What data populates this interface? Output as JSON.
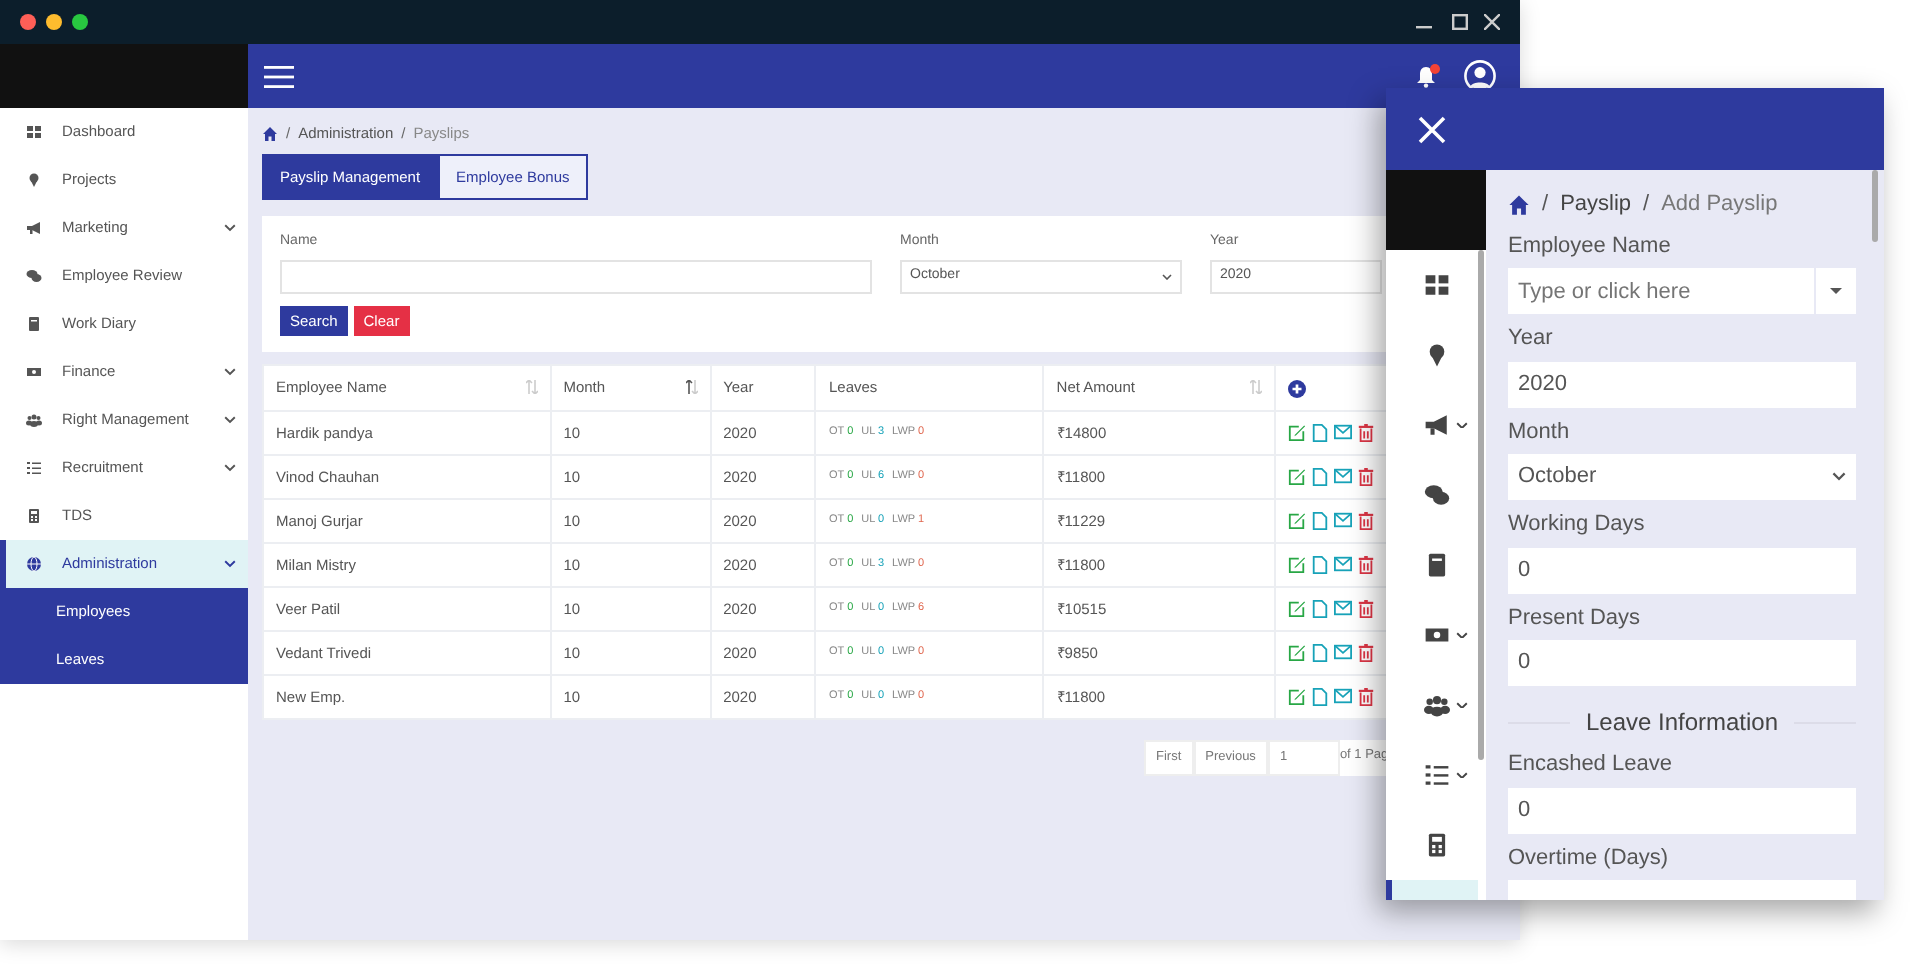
{
  "sidebar": {
    "items": [
      {
        "label": "Dashboard",
        "submenu": false,
        "selected": false
      },
      {
        "label": "Projects",
        "submenu": false,
        "selected": false
      },
      {
        "label": "Marketing",
        "submenu": true,
        "selected": false
      },
      {
        "label": "Employee Review",
        "submenu": false,
        "selected": false
      },
      {
        "label": "Work Diary",
        "submenu": false,
        "selected": false
      },
      {
        "label": "Finance",
        "submenu": true,
        "selected": false
      },
      {
        "label": "Right Management",
        "submenu": true,
        "selected": false
      },
      {
        "label": "Recruitment",
        "submenu": true,
        "selected": false
      },
      {
        "label": "TDS",
        "submenu": false,
        "selected": false
      },
      {
        "label": "Administration",
        "submenu": true,
        "selected": true,
        "expanded": true,
        "children": [
          {
            "label": "Employees",
            "selected": false
          },
          {
            "label": "Leaves",
            "selected": false
          }
        ]
      }
    ]
  },
  "topbar": {
    "notification_badge": true
  },
  "breadcrumb": [
    {
      "kind": "separator",
      "text": "/"
    },
    {
      "kind": "link",
      "text": "Administration"
    },
    {
      "kind": "separator",
      "text": "/"
    },
    {
      "kind": "current",
      "text": "Payslips"
    }
  ],
  "tabs": [
    {
      "label": "Payslip Management",
      "selected": true
    },
    {
      "label": "Employee Bonus",
      "selected": false
    }
  ],
  "filters": {
    "fields": [
      {
        "label": "Name",
        "kind": "text"
      },
      {
        "label": "Month",
        "kind": "select",
        "value": "October"
      },
      {
        "label": "Year",
        "kind": "text",
        "value": "2020"
      }
    ],
    "buttons": [
      {
        "label": "Search",
        "kind": "primary"
      },
      {
        "label": "Clear",
        "kind": "danger"
      }
    ]
  },
  "table": {
    "columns": [
      {
        "label": "Employee Name",
        "sortable": true,
        "sorted": false
      },
      {
        "label": "Month",
        "sortable": true,
        "sorted": true
      },
      {
        "label": "Year",
        "sortable": false
      },
      {
        "label": "Leaves",
        "sortable": false
      },
      {
        "label": "Net Amount",
        "sortable": true,
        "sorted": false
      },
      {
        "kind": "add"
      }
    ],
    "rows": [
      {
        "name": "Hardik pandya",
        "month": "10",
        "year": "2020",
        "leaves": [
          {
            "label": "OT",
            "value": "0"
          },
          {
            "label": "UL",
            "value": "3"
          },
          {
            "label": "LWP",
            "value": "0"
          }
        ],
        "net": "₹14800"
      },
      {
        "name": "Vinod Chauhan",
        "month": "10",
        "year": "2020",
        "leaves": [
          {
            "label": "OT",
            "value": "0"
          },
          {
            "label": "UL",
            "value": "6"
          },
          {
            "label": "LWP",
            "value": "0"
          }
        ],
        "net": "₹11800"
      },
      {
        "name": "Manoj Gurjar",
        "month": "10",
        "year": "2020",
        "leaves": [
          {
            "label": "OT",
            "value": "0"
          },
          {
            "label": "UL",
            "value": "0"
          },
          {
            "label": "LWP",
            "value": "1"
          }
        ],
        "net": "₹11229"
      },
      {
        "name": "Milan Mistry",
        "month": "10",
        "year": "2020",
        "leaves": [
          {
            "label": "OT",
            "value": "0"
          },
          {
            "label": "UL",
            "value": "3"
          },
          {
            "label": "LWP",
            "value": "0"
          }
        ],
        "net": "₹11800"
      },
      {
        "name": "Veer Patil",
        "month": "10",
        "year": "2020",
        "leaves": [
          {
            "label": "OT",
            "value": "0"
          },
          {
            "label": "UL",
            "value": "0"
          },
          {
            "label": "LWP",
            "value": "6"
          }
        ],
        "net": "₹10515"
      },
      {
        "name": "Vedant Trivedi",
        "month": "10",
        "year": "2020",
        "leaves": [
          {
            "label": "OT",
            "value": "0"
          },
          {
            "label": "UL",
            "value": "0"
          },
          {
            "label": "LWP",
            "value": "0"
          }
        ],
        "net": "₹9850"
      },
      {
        "name": "New Emp.",
        "month": "10",
        "year": "2020",
        "leaves": [
          {
            "label": "OT",
            "value": "0"
          },
          {
            "label": "UL",
            "value": "0"
          },
          {
            "label": "LWP",
            "value": "0"
          }
        ],
        "net": "₹11800"
      }
    ]
  },
  "pagination": {
    "buttons": [
      "First",
      "Previous"
    ],
    "page": "1",
    "total": "of 1 Pag"
  },
  "panel": {
    "breadcrumb": [
      {
        "kind": "separator",
        "text": "/"
      },
      {
        "kind": "link",
        "text": "Payslip"
      },
      {
        "kind": "separator",
        "text": "/"
      },
      {
        "kind": "current",
        "text": "Add Payslip"
      }
    ],
    "rail": [
      {
        "submenu": false,
        "selected": false
      },
      {
        "submenu": false,
        "selected": false
      },
      {
        "submenu": true,
        "selected": false
      },
      {
        "submenu": false,
        "selected": false
      },
      {
        "submenu": false,
        "selected": false
      },
      {
        "submenu": true,
        "selected": false
      },
      {
        "submenu": true,
        "selected": false
      },
      {
        "submenu": true,
        "selected": false
      },
      {
        "submenu": false,
        "selected": false
      },
      {
        "submenu": false,
        "selected": true
      }
    ],
    "fields": [
      {
        "label": "Employee Name",
        "kind": "combo",
        "placeholder": "Type or click here"
      },
      {
        "label": "Year",
        "kind": "text",
        "value": "2020"
      },
      {
        "label": "Month",
        "kind": "select",
        "value": "October"
      },
      {
        "label": "Working Days",
        "kind": "text",
        "value": "0"
      },
      {
        "label": "Present Days",
        "kind": "text",
        "value": "0"
      },
      {
        "label": "Leave Information",
        "kind": "section"
      },
      {
        "label": "Encashed Leave",
        "kind": "text",
        "value": "0"
      },
      {
        "label": "Overtime (Days)",
        "kind": "text"
      }
    ]
  }
}
